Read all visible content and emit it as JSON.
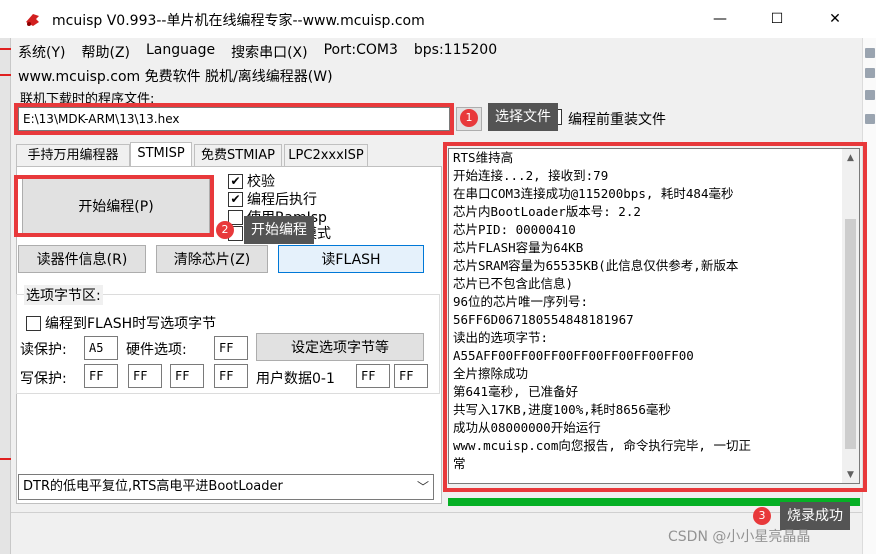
{
  "window": {
    "title": "mcuisp V0.993--单片机在线编程专家--www.mcuisp.com",
    "minimize_symbol": "—",
    "maximize_symbol": "☐",
    "close_symbol": "✕"
  },
  "menu": {
    "items": [
      "系统(Y)",
      "帮助(Z)",
      "Language",
      "搜索串口(X)",
      "Port:COM3",
      "bps:115200"
    ]
  },
  "info_line": "www.mcuisp.com 免费软件 脱机/离线编程器(W)",
  "file": {
    "label": "联机下载时的程序文件:",
    "path": "E:\\13\\MDK-ARM\\13\\13.hex",
    "reload_label": "编程前重装文件"
  },
  "tabs": [
    "手持万用编程器",
    "STMISP",
    "免费STMIAP",
    "LPC2xxxISP"
  ],
  "active_tab": 1,
  "start_button": "开始编程(P)",
  "options": [
    {
      "label": "校验",
      "checked": true
    },
    {
      "label": "编程后执行",
      "checked": true
    },
    {
      "label": "使用RamIsp",
      "checked": false
    },
    {
      "label": "连续编程模式",
      "checked": false
    }
  ],
  "actions": {
    "read_info": "读器件信息(R)",
    "erase": "清除芯片(Z)",
    "read_flash": "读FLASH"
  },
  "option_bytes": {
    "group_title": "选项字节区:",
    "write_opt_label": "编程到FLASH时写选项字节",
    "read_protect_label": "读保护:",
    "read_protect_value": "A5",
    "hw_option_label": "硬件选项:",
    "hw_option_value": "FF",
    "set_button": "设定选项字节等",
    "write_protect_label": "写保护:",
    "write_protect_values": [
      "FF",
      "FF",
      "FF",
      "FF"
    ],
    "user_data_label": "用户数据0-1",
    "user_data_values": [
      "FF",
      "FF"
    ]
  },
  "reset_mode": "DTR的低电平复位,RTS高电平进BootLoader",
  "log": [
    "RTS维持高",
    "开始连接...2, 接收到:79",
    "在串口COM3连接成功@115200bps, 耗时484毫秒",
    "芯片内BootLoader版本号: 2.2",
    "芯片PID: 00000410",
    "芯片FLASH容量为64KB",
    "芯片SRAM容量为65535KB(此信息仅供参考,新版本",
    "芯片已不包含此信息)",
    "96位的芯片唯一序列号:",
    "56FF6D067180554848181967",
    "读出的选项字节:",
    "A55AFF00FF00FF00FF00FF00FF00FF00",
    "全片擦除成功",
    "第641毫秒, 已准备好",
    "共写入17KB,进度100%,耗时8656毫秒",
    "成功从08000000开始运行",
    "www.mcuisp.com向您报告, 命令执行完毕, 一切正",
    "常"
  ],
  "progress_fraction": 1.0,
  "annotations": [
    {
      "number": "1",
      "text": "选择文件"
    },
    {
      "number": "2",
      "text": "开始编程"
    },
    {
      "number": "3",
      "text": "烧录成功"
    }
  ],
  "watermark": "CSDN @小小星亮晶晶",
  "colors": {
    "highlight": "#e8393b",
    "callout_bg": "#545454",
    "progress": "#06b025",
    "focus": "#0078d7"
  }
}
